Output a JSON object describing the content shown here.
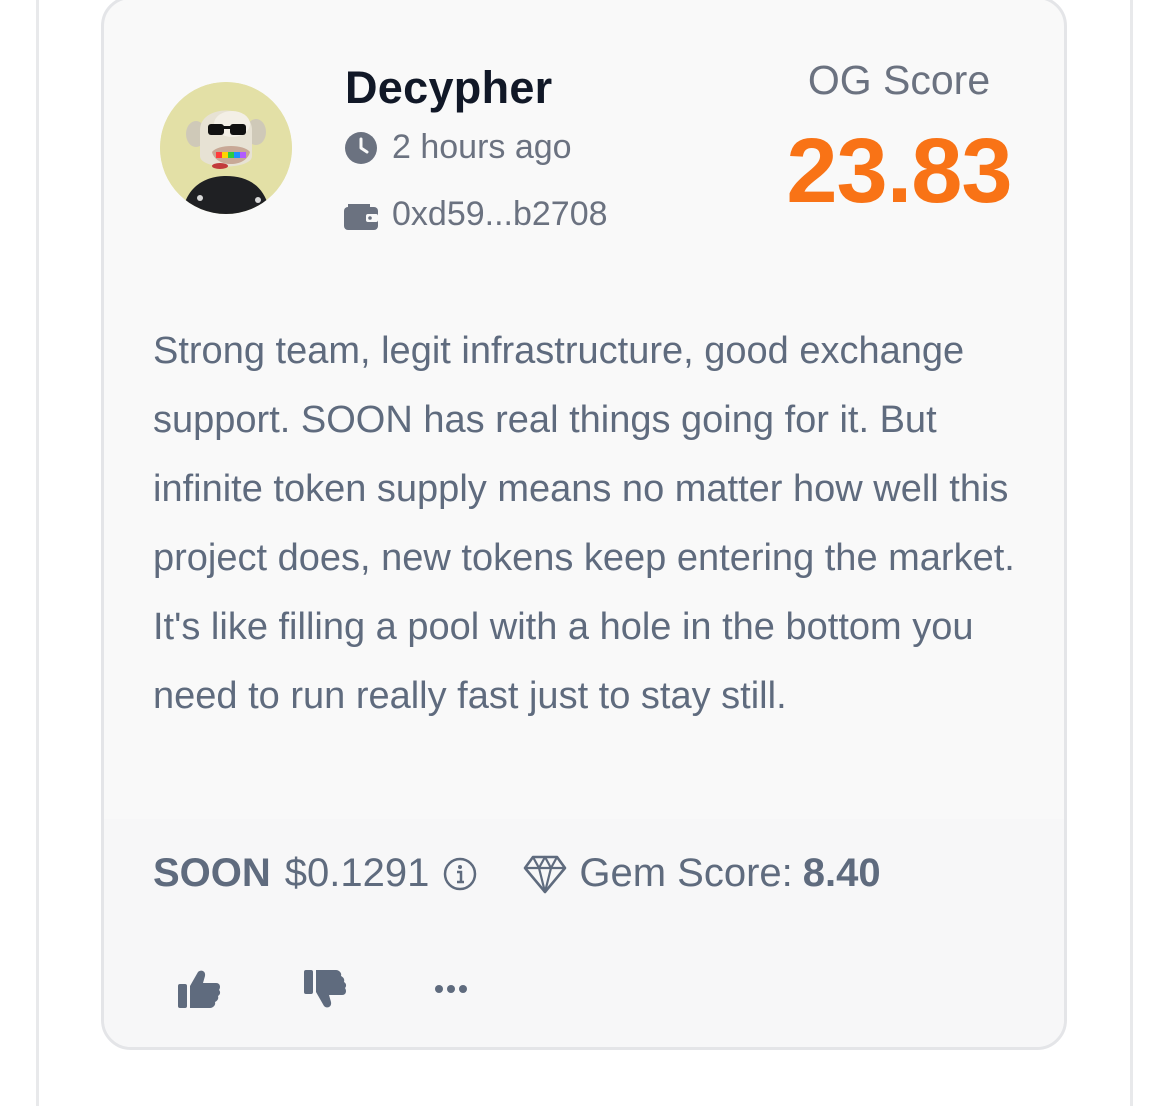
{
  "review_card": {
    "username": "Decypher",
    "time_ago": "2 hours ago",
    "wallet_address": "0xd59...b2708",
    "og_score_label": "OG Score",
    "og_score_value": "23.83",
    "review_text": "Strong team, legit infrastructure, good exchange support. SOON has real things going for it. But infinite token supply means no matter how well this project does, new tokens keep entering the market. It's like filling a pool with a hole in the bottom you need to run really fast just to stay still.",
    "token": {
      "ticker": "SOON",
      "price": "$0.1291",
      "gem_score_label": "Gem Score:",
      "gem_score_value": "8.40"
    },
    "icons": {
      "time": "clock-icon",
      "wallet": "wallet-icon",
      "price_info": "info-icon",
      "gem": "diamond-icon",
      "like": "thumbs-up-icon",
      "dislike": "thumbs-down-icon",
      "more": "more-icon"
    }
  },
  "colors": {
    "score_accent": "#f97316",
    "text_primary": "#111827",
    "text_secondary": "#6b7280",
    "card_background": "#f9f9f9",
    "card_border": "#e4e5e8"
  }
}
